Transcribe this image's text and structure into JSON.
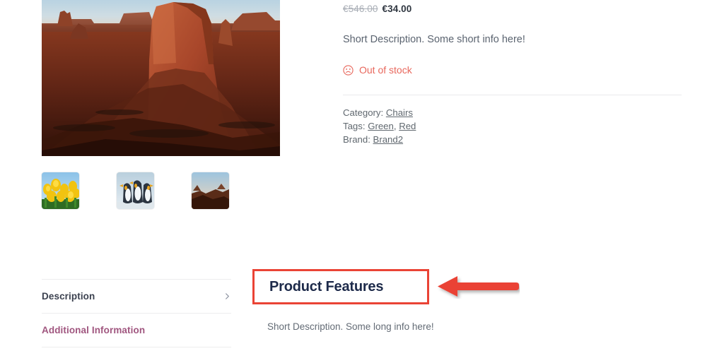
{
  "product": {
    "price": {
      "old": "€546.00",
      "new": "€34.00"
    },
    "short_description": "Short Description. Some short info here!",
    "stock_status": {
      "label": "Out of stock",
      "icon": "frowning-face-icon",
      "color": "#e8675c"
    },
    "meta": {
      "category_label": "Category:",
      "category_value": "Chairs",
      "tags_label": "Tags:",
      "tag_values": [
        "Green",
        "Red"
      ],
      "tags_separator": ", ",
      "brand_label": "Brand:",
      "brand_value": "Brand2"
    },
    "gallery": {
      "main_image_alt": "monument-valley-desert-buttes-photo",
      "thumbnails": [
        {
          "alt": "yellow-tulips-photo"
        },
        {
          "alt": "king-penguins-photo"
        },
        {
          "alt": "desert-cliffs-sunset-photo"
        }
      ]
    }
  },
  "tabs": [
    {
      "label": "Description",
      "state": "active",
      "chevron": "chevron-right-icon"
    },
    {
      "label": "Additional Information",
      "state": "inactive",
      "chevron": ""
    }
  ],
  "panel": {
    "title": "Product Features",
    "body": "Short Description. Some long info here!",
    "highlight_color": "#ea4335"
  },
  "annotation": {
    "arrow": "left-pointing-arrow",
    "color": "#ea4335"
  }
}
